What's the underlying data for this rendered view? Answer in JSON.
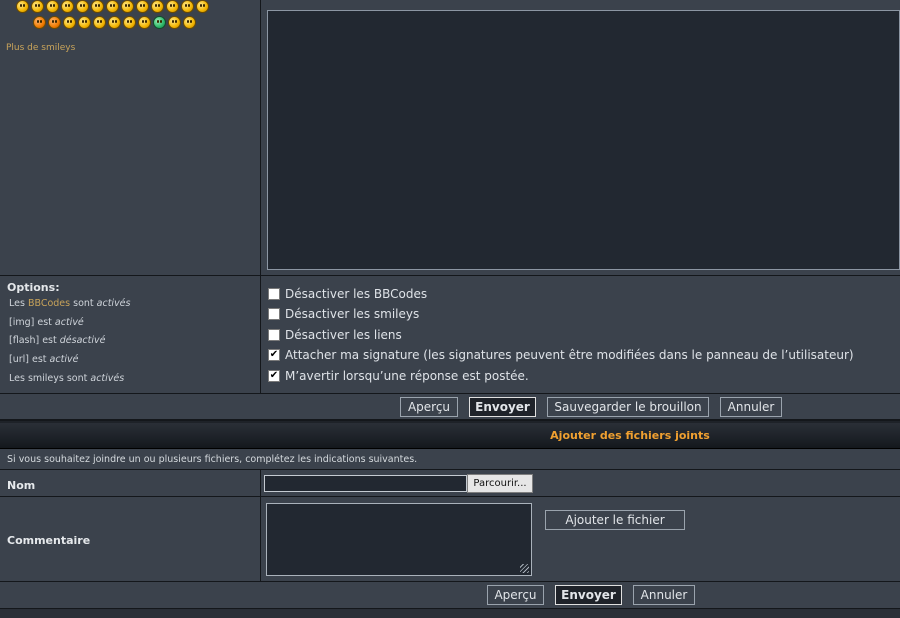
{
  "smileys": {
    "more_label": "Plus de smileys"
  },
  "options": {
    "title": "Options:",
    "lines": [
      {
        "prefix": "Les ",
        "link": "BBCodes",
        "middle": " sont ",
        "state": "activés"
      },
      {
        "prefix": "[img] est ",
        "link": "",
        "middle": "",
        "state": "activé"
      },
      {
        "prefix": "[flash] est ",
        "link": "",
        "middle": "",
        "state": "désactivé"
      },
      {
        "prefix": "[url] est ",
        "link": "",
        "middle": "",
        "state": "activé"
      },
      {
        "prefix": "Les smileys sont ",
        "link": "",
        "middle": "",
        "state": "activés"
      }
    ],
    "checkboxes": [
      {
        "label": "Désactiver les BBCodes",
        "checked": false
      },
      {
        "label": "Désactiver les smileys",
        "checked": false
      },
      {
        "label": "Désactiver les liens",
        "checked": false
      },
      {
        "label": "Attacher ma signature (les signatures peuvent être modifiées dans le panneau de l’utilisateur)",
        "checked": true
      },
      {
        "label": "M’avertir lorsqu’une réponse est postée.",
        "checked": true
      }
    ]
  },
  "submit": {
    "preview": "Aperçu",
    "send": "Envoyer",
    "save_draft": "Sauvegarder le brouillon",
    "cancel": "Annuler"
  },
  "attachments": {
    "title": "Ajouter des fichiers joints",
    "info": "Si vous souhaitez joindre un ou plusieurs fichiers, complétez les indications suivantes.",
    "name_label": "Nom",
    "browse_label": "Parcourir...",
    "comment_label": "Commentaire",
    "add_file_label": "Ajouter le fichier",
    "preview": "Aperçu",
    "send": "Envoyer",
    "cancel": "Annuler"
  }
}
